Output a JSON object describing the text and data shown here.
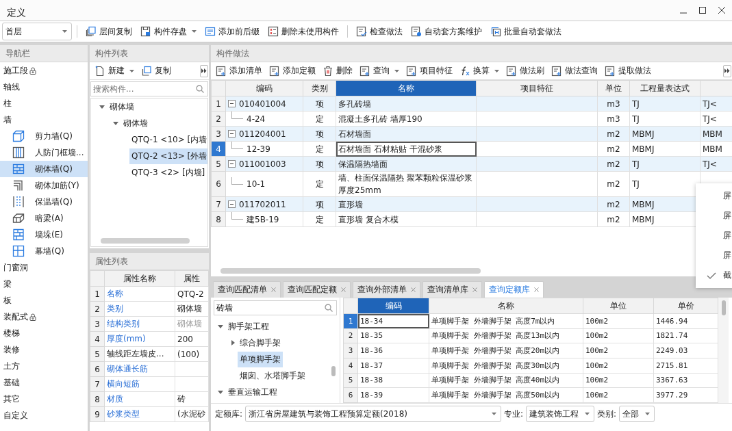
{
  "window": {
    "title": "定义"
  },
  "toolbar": {
    "floor_select": "首层",
    "buttons": [
      {
        "label": "层间复制",
        "dropdown": false
      },
      {
        "label": "构件存盘",
        "dropdown": true
      },
      {
        "label": "添加前后缀",
        "dropdown": false
      },
      {
        "label": "删除未使用构件",
        "dropdown": false
      },
      {
        "label": "检查做法",
        "dropdown": false
      },
      {
        "label": "自动套方案维护",
        "dropdown": false
      },
      {
        "label": "批量自动套做法",
        "dropdown": false
      }
    ]
  },
  "navigation": {
    "title": "导航栏",
    "items": [
      {
        "label": "施工段",
        "locked": true,
        "selected": false
      },
      {
        "label": "轴线",
        "locked": false,
        "selected": false
      },
      {
        "label": "柱",
        "locked": false,
        "selected": false
      },
      {
        "label": "墙",
        "locked": false,
        "selected": false,
        "children": [
          {
            "label": "剪力墙(Q)",
            "selected": false
          },
          {
            "label": "人防门框墙...",
            "selected": false
          },
          {
            "label": "砌体墙(Q)",
            "selected": true
          },
          {
            "label": "砌体加筋(Y)",
            "selected": false
          },
          {
            "label": "保温墙(Q)",
            "selected": false
          },
          {
            "label": "暗梁(A)",
            "selected": false
          },
          {
            "label": "墙垛(E)",
            "selected": false
          },
          {
            "label": "幕墙(Q)",
            "selected": false
          }
        ]
      },
      {
        "label": "门窗洞",
        "locked": false,
        "selected": false
      },
      {
        "label": "梁",
        "locked": false,
        "selected": false
      },
      {
        "label": "板",
        "locked": false,
        "selected": false
      },
      {
        "label": "装配式",
        "locked": true,
        "selected": false
      },
      {
        "label": "楼梯",
        "locked": false,
        "selected": false
      },
      {
        "label": "装修",
        "locked": false,
        "selected": false
      },
      {
        "label": "土方",
        "locked": false,
        "selected": false
      },
      {
        "label": "基础",
        "locked": false,
        "selected": false
      },
      {
        "label": "其它",
        "locked": false,
        "selected": false
      },
      {
        "label": "自定义",
        "locked": false,
        "selected": false
      }
    ]
  },
  "component_list": {
    "title": "构件列表",
    "buttons": [
      {
        "label": "新建",
        "dropdown": true
      },
      {
        "label": "复制",
        "dropdown": false
      }
    ],
    "search": {
      "placeholder": "搜索构件..."
    },
    "tree": [
      {
        "label": "砌体墙",
        "expanded": true,
        "selected": false,
        "children": [
          {
            "label": "砌体墙",
            "expanded": true,
            "selected": false,
            "children": [
              {
                "label": "QTQ-1 <10> [内墙",
                "selected": false
              },
              {
                "label": "QTQ-2 <13> [外墙",
                "selected": true
              },
              {
                "label": "QTQ-3 <2> [内墙]",
                "selected": false
              }
            ]
          }
        ]
      }
    ]
  },
  "properties": {
    "title": "属性列表",
    "columns": [
      "属性名称",
      "属性"
    ],
    "rows": [
      {
        "index": "1",
        "name": "名称",
        "value": "QTQ-2",
        "linked": true,
        "disabled": false
      },
      {
        "index": "2",
        "name": "类别",
        "value": "砌体墙",
        "linked": true,
        "disabled": false
      },
      {
        "index": "3",
        "name": "结构类别",
        "value": "砌体墙",
        "linked": true,
        "disabled": true
      },
      {
        "index": "4",
        "name": "厚度(mm)",
        "value": "200",
        "linked": true,
        "disabled": false
      },
      {
        "index": "5",
        "name": "轴线距左墙皮...",
        "value": "(100)",
        "linked": false,
        "disabled": false
      },
      {
        "index": "6",
        "name": "砌体通长筋",
        "linked": true,
        "disabled": false
      },
      {
        "index": "7",
        "name": "横向短筋",
        "linked": true,
        "disabled": false
      },
      {
        "index": "8",
        "name": "材质",
        "value": "砖",
        "linked": true,
        "disabled": false
      },
      {
        "index": "9",
        "name": "砂浆类型",
        "value": "(水泥砂",
        "linked": true,
        "disabled": false
      }
    ]
  },
  "methods": {
    "title": "构件做法",
    "toolbar": [
      {
        "label": "添加清单",
        "dropdown": false
      },
      {
        "label": "添加定额",
        "dropdown": false
      },
      {
        "label": "删除",
        "dropdown": false
      },
      {
        "label": "查询",
        "dropdown": true
      },
      {
        "label": "项目特征",
        "dropdown": false
      },
      {
        "label": "换算",
        "dropdown": true
      },
      {
        "label": "做法刷",
        "dropdown": false
      },
      {
        "label": "做法查询",
        "dropdown": false
      },
      {
        "label": "提取做法",
        "dropdown": false
      }
    ],
    "columns": [
      {
        "label": "编码",
        "selected": false
      },
      {
        "label": "类别",
        "selected": false
      },
      {
        "label": "名称",
        "selected": true
      },
      {
        "label": "项目特征",
        "selected": false
      },
      {
        "label": "单位",
        "selected": false
      },
      {
        "label": "工程量表达式",
        "selected": false
      }
    ],
    "rows": [
      {
        "index": "1",
        "kind": "item",
        "code": "010401004",
        "type": "项",
        "name": "多孔砖墙",
        "unit": "m3",
        "expression": "TJ",
        "column_8": "TJ<",
        "selected": false
      },
      {
        "index": "2",
        "kind": "quota",
        "code": "4-24",
        "type": "定",
        "name": "混凝土多孔砖 墙厚190",
        "unit": "m3",
        "expression": "TJ",
        "column_8": "TJ<",
        "selected": false
      },
      {
        "index": "3",
        "kind": "item",
        "code": "011204001",
        "type": "项",
        "name": "石材墙面",
        "unit": "m2",
        "expression": "MBMJ",
        "column_8": "MBM",
        "selected": false
      },
      {
        "index": "4",
        "kind": "quota",
        "code": "12-39",
        "type": "定",
        "name": "石材墙面 石材粘贴 干混砂浆",
        "unit": "m2",
        "expression": "MBMJ",
        "column_8": "MBM",
        "selected": true
      },
      {
        "index": "5",
        "kind": "item",
        "code": "011001003",
        "type": "项",
        "name": "保温隔热墙面",
        "unit": "m2",
        "expression": "TJ",
        "column_8": "TJ<",
        "selected": false
      },
      {
        "index": "6",
        "kind": "quota",
        "code": "10-1",
        "type": "定",
        "name": "墙、柱面保温隔热 聚苯颗粒保温砂浆厚度25mm",
        "unit": "m2",
        "expression": "TJ",
        "selected": false
      },
      {
        "index": "7",
        "kind": "item",
        "code": "011702011",
        "type": "项",
        "name": "直形墙",
        "unit": "m2",
        "expression": "MBMJ",
        "selected": false
      },
      {
        "index": "8",
        "kind": "quota",
        "code": "建5B-19",
        "type": "定",
        "name": "直形墙 复合木模",
        "unit": "m2",
        "expression": "MBMJ",
        "selected": false
      }
    ]
  },
  "query_tabs": [
    {
      "label": "查询匹配清单",
      "selected": false
    },
    {
      "label": "查询匹配定额",
      "selected": false
    },
    {
      "label": "查询外部清单",
      "selected": false
    },
    {
      "label": "查询清单库",
      "selected": false
    },
    {
      "label": "查询定额库",
      "selected": true
    }
  ],
  "quota_library": {
    "search": {
      "value": "砖墙"
    },
    "tree": [
      {
        "label": "脚手架工程",
        "expanded": true,
        "selected": false,
        "children": [
          {
            "label": "综合脚手架",
            "expanded": false,
            "selected": false
          },
          {
            "label": "单项脚手架",
            "selected": true
          },
          {
            "label": "烟囱、水塔脚手架",
            "selected": false
          }
        ]
      },
      {
        "label": "垂直运输工程",
        "expanded": true,
        "selected": false
      }
    ],
    "columns": [
      {
        "label": "编码",
        "selected": true
      },
      {
        "label": "名称",
        "selected": false
      },
      {
        "label": "单位",
        "selected": false
      },
      {
        "label": "单价",
        "selected": false
      }
    ],
    "rows": [
      {
        "index": "1",
        "code": "18-34",
        "name": "单项脚手架 外墙脚手架 高度7m以内",
        "unit": "100m2",
        "price": "1446.94",
        "selected": true
      },
      {
        "index": "2",
        "code": "18-35",
        "name": "单项脚手架 外墙脚手架 高度13m以内",
        "unit": "100m2",
        "price": "1821.74",
        "selected": false
      },
      {
        "index": "3",
        "code": "18-36",
        "name": "单项脚手架 外墙脚手架 高度20m以内",
        "unit": "100m2",
        "price": "2249.03",
        "selected": false
      },
      {
        "index": "4",
        "code": "18-37",
        "name": "单项脚手架 外墙脚手架 高度30m以内",
        "unit": "100m2",
        "price": "2715.81",
        "selected": false
      },
      {
        "index": "5",
        "code": "18-38",
        "name": "单项脚手架 外墙脚手架 高度40m以内",
        "unit": "100m2",
        "price": "3367.63",
        "selected": false
      },
      {
        "index": "6",
        "code": "18-39",
        "name": "单项脚手架 外墙脚手架 高度50m以内",
        "unit": "100m2",
        "price": "3977.29",
        "selected": false
      }
    ],
    "footer": {
      "library_label": "定额库:",
      "library": "浙江省房屋建筑与装饰工程预算定额(2018)",
      "specialty_label": "专业:",
      "specialty": "建筑装饰工程",
      "category_label": "类别:",
      "category": "全部"
    }
  },
  "context_menu": {
    "items": [
      {
        "label": "屏",
        "checked": false
      },
      {
        "label": "屏",
        "checked": false
      },
      {
        "label": "屏",
        "checked": false
      },
      {
        "label": "屏",
        "checked": false
      },
      {
        "label": "截",
        "checked": true
      }
    ]
  }
}
